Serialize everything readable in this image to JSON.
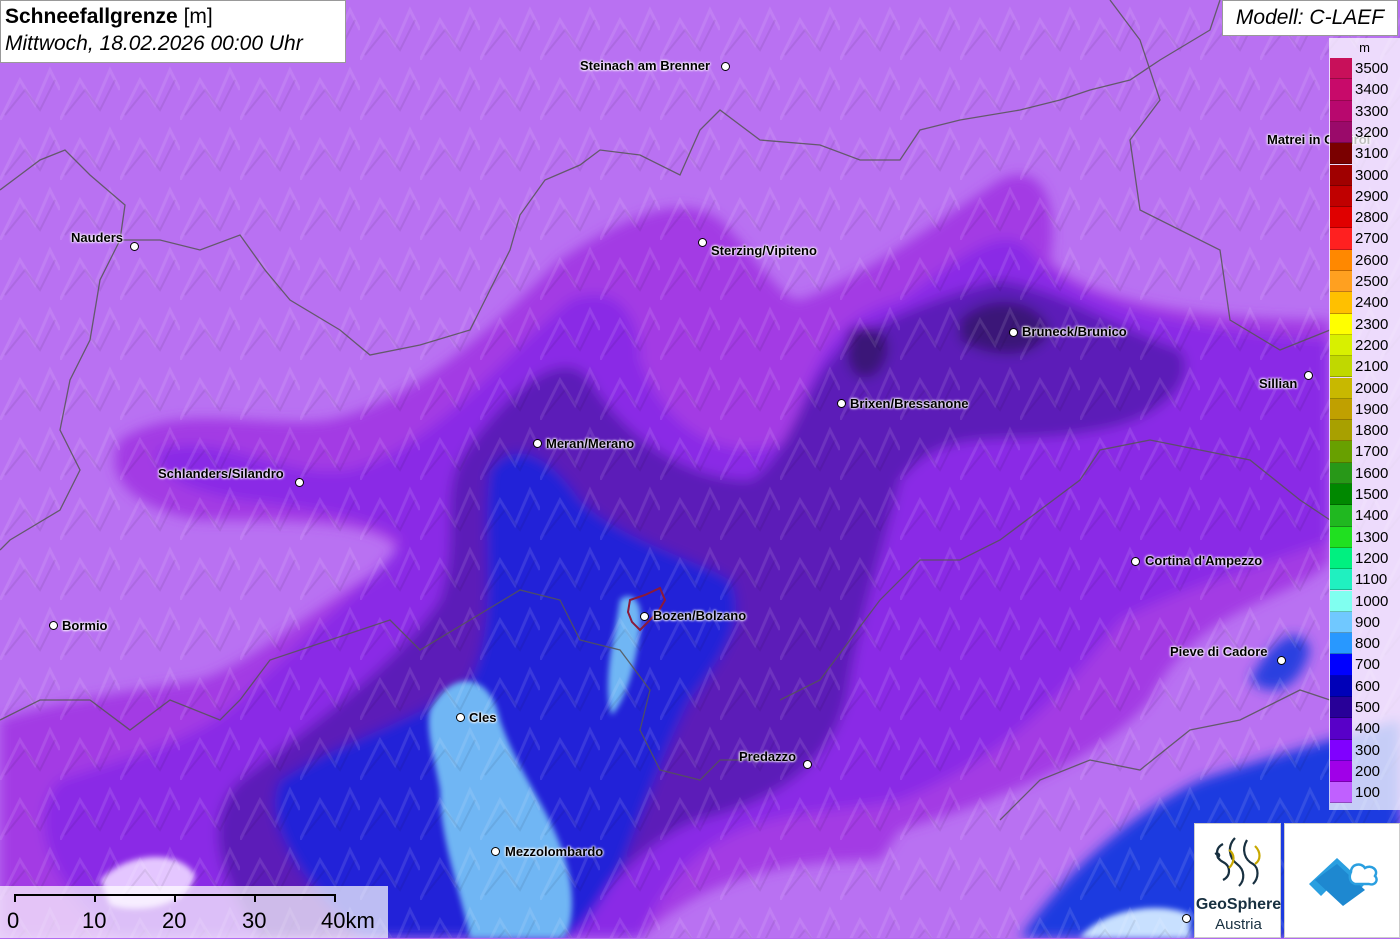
{
  "title": {
    "main": "Schneefallgrenze",
    "unit": "[m]",
    "date": "Mittwoch, 18.02.2026 00:00 Uhr"
  },
  "model": "Modell: C-LAEF",
  "legend": {
    "unit": "m",
    "items": [
      {
        "label": "3500",
        "color": "#c8105a"
      },
      {
        "label": "3400",
        "color": "#c80a6a"
      },
      {
        "label": "3300",
        "color": "#b8086e"
      },
      {
        "label": "3200",
        "color": "#9a0a6a"
      },
      {
        "label": "3100",
        "color": "#7a0000"
      },
      {
        "label": "3000",
        "color": "#a00000"
      },
      {
        "label": "2900",
        "color": "#c00000"
      },
      {
        "label": "2800",
        "color": "#e00000"
      },
      {
        "label": "2700",
        "color": "#ff2020"
      },
      {
        "label": "2600",
        "color": "#ff8800"
      },
      {
        "label": "2500",
        "color": "#ffa020"
      },
      {
        "label": "2400",
        "color": "#ffc000"
      },
      {
        "label": "2300",
        "color": "#ffff00"
      },
      {
        "label": "2200",
        "color": "#d8f000"
      },
      {
        "label": "2100",
        "color": "#c0d800"
      },
      {
        "label": "2000",
        "color": "#c8b800"
      },
      {
        "label": "1900",
        "color": "#c0a000"
      },
      {
        "label": "1800",
        "color": "#a8a000"
      },
      {
        "label": "1700",
        "color": "#68a000"
      },
      {
        "label": "1600",
        "color": "#289818"
      },
      {
        "label": "1500",
        "color": "#008800"
      },
      {
        "label": "1400",
        "color": "#20b820"
      },
      {
        "label": "1300",
        "color": "#20e020"
      },
      {
        "label": "1200",
        "color": "#00f080"
      },
      {
        "label": "1100",
        "color": "#20f0c0"
      },
      {
        "label": "1000",
        "color": "#80fff0"
      },
      {
        "label": "900",
        "color": "#70c8ff"
      },
      {
        "label": "800",
        "color": "#2898ff"
      },
      {
        "label": "700",
        "color": "#0000ff"
      },
      {
        "label": "600",
        "color": "#0000b8"
      },
      {
        "label": "500",
        "color": "#280098"
      },
      {
        "label": "400",
        "color": "#5800c8"
      },
      {
        "label": "300",
        "color": "#8000ff"
      },
      {
        "label": "200",
        "color": "#a000e8"
      },
      {
        "label": "100",
        "color": "#c060ff"
      }
    ]
  },
  "cities": [
    {
      "name": "Steinach am Brenner",
      "side": "left"
    },
    {
      "name": "Nauders",
      "side": "left"
    },
    {
      "name": "Sterzing/Vipiteno",
      "side": "right"
    },
    {
      "name": "Matrei in Osttirol",
      "side": "left"
    },
    {
      "name": "Bruneck/Brunico",
      "side": "right"
    },
    {
      "name": "Sillian",
      "side": "left"
    },
    {
      "name": "Brixen/Bressanone",
      "side": "right"
    },
    {
      "name": "Meran/Merano",
      "side": "right"
    },
    {
      "name": "Schlanders/Silandro",
      "side": "left"
    },
    {
      "name": "Cortina d'Ampezzo",
      "side": "right"
    },
    {
      "name": "Bormio",
      "side": "right"
    },
    {
      "name": "Bozen/Bolzano",
      "side": "right"
    },
    {
      "name": "Pieve di Cadore",
      "side": "left"
    },
    {
      "name": "Cles",
      "side": "right"
    },
    {
      "name": "Predazzo",
      "side": "left"
    },
    {
      "name": "Mezzolombardo",
      "side": "right"
    }
  ],
  "scale": {
    "labels": [
      "0",
      "10",
      "20",
      "30",
      "40km"
    ]
  },
  "logos": {
    "geosphere_name": "GeoSphere",
    "geosphere_sub": "Austria"
  }
}
